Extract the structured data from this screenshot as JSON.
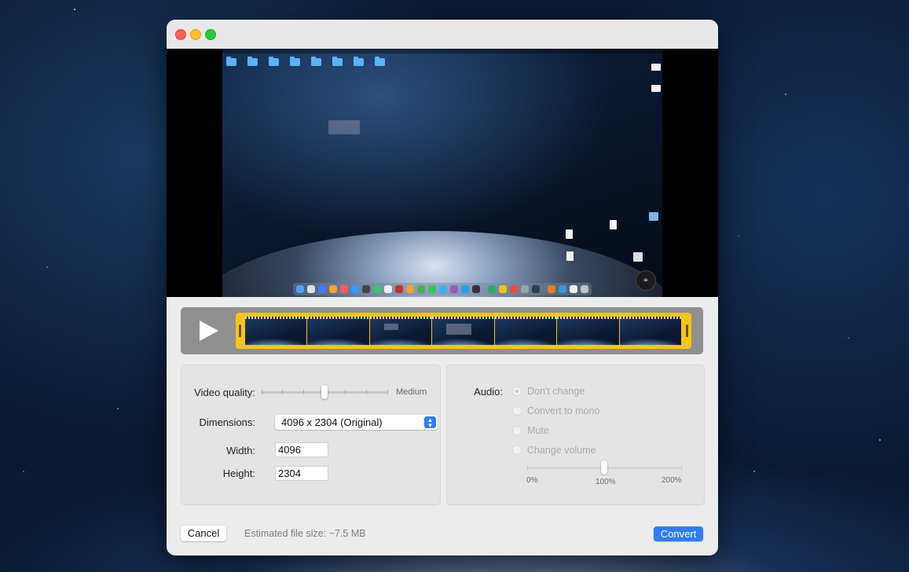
{
  "window": {
    "traffic_lights": [
      "close",
      "minimize",
      "zoom"
    ]
  },
  "timeline": {
    "play_icon": "play-icon"
  },
  "video": {
    "quality_label": "Video quality:",
    "quality_value": "Medium",
    "quality_fraction": 0.5,
    "dimensions_label": "Dimensions:",
    "dimensions_value": "4096 x 2304  (Original)",
    "width_label": "Width:",
    "width_value": "4096",
    "height_label": "Height:",
    "height_value": "2304"
  },
  "audio": {
    "label": "Audio:",
    "options": [
      "Don't change",
      "Convert to mono",
      "Mute",
      "Change volume"
    ],
    "selected_index": 0,
    "volume_min": "0%",
    "volume_mid": "100%",
    "volume_max": "200%",
    "volume_fraction": 0.5
  },
  "footer": {
    "cancel_label": "Cancel",
    "estimate": "Estimated file size: ~7.5 MB",
    "convert_label": "Convert"
  },
  "colors": {
    "accent": "#2f7cf6",
    "timeline_strip": "#f8c514"
  }
}
